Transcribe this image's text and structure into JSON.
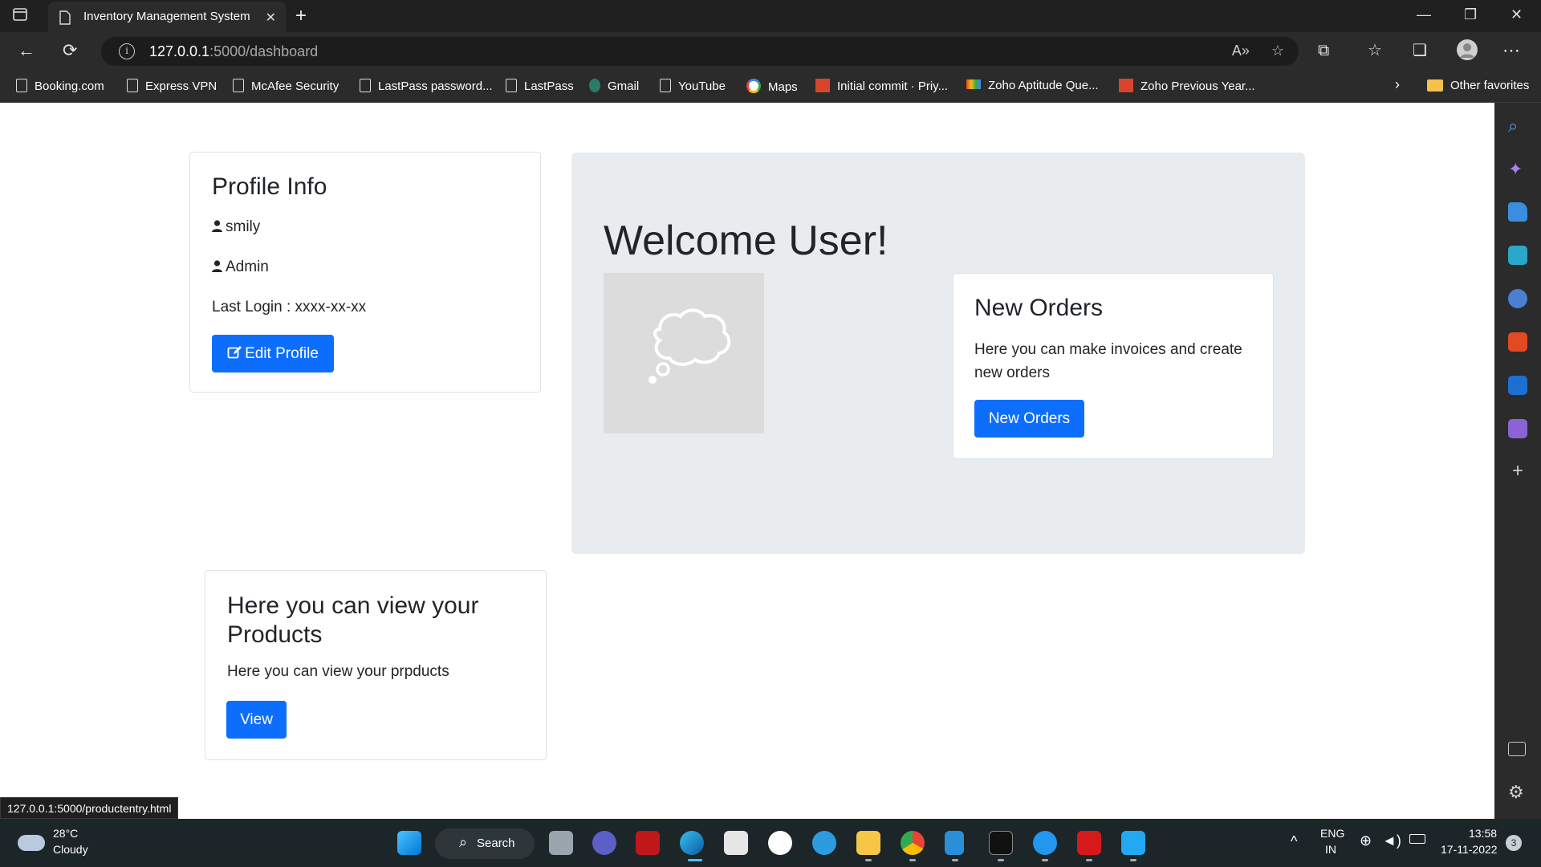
{
  "browser": {
    "tab_title": "Inventory Management System",
    "url_host": "127.0.0.1",
    "url_path": ":5000/dashboard",
    "bookmarks": [
      {
        "label": "Booking.com",
        "icon": "file-icon"
      },
      {
        "label": "Express VPN",
        "icon": "file-icon"
      },
      {
        "label": "McAfee Security",
        "icon": "file-icon"
      },
      {
        "label": "LastPass password...",
        "icon": "file-icon"
      },
      {
        "label": "LastPass",
        "icon": "file-icon"
      },
      {
        "label": "Gmail",
        "icon": "gmail-icon"
      },
      {
        "label": "YouTube",
        "icon": "file-icon"
      },
      {
        "label": "Maps",
        "icon": "google-icon"
      },
      {
        "label": "Initial commit · Priy...",
        "icon": "site-icon"
      },
      {
        "label": "Zoho Aptitude Que...",
        "icon": "gmail-m-icon"
      },
      {
        "label": "Zoho Previous Year...",
        "icon": "site-icon"
      }
    ],
    "other_favorites": "Other favorites",
    "status_url": "127.0.0.1:5000/productentry.html"
  },
  "profile": {
    "title": "Profile Info",
    "username": "smily",
    "role": "Admin",
    "last_login": "Last Login : xxxx-xx-xx",
    "edit_button": "Edit Profile"
  },
  "welcome": {
    "heading": "Welcome User!"
  },
  "orders": {
    "title": "New Orders",
    "text": "Here you can make invoices and create new orders",
    "button": "New Orders"
  },
  "products": {
    "title": "Here you can view your Products",
    "text": "Here you can view your prpducts",
    "button": "View"
  },
  "taskbar": {
    "weather_temp": "28°C",
    "weather_desc": "Cloudy",
    "search_label": "Search",
    "lang_top": "ENG",
    "lang_bottom": "IN",
    "time": "13:58",
    "date": "17-11-2022",
    "notification_count": "3"
  },
  "colors": {
    "primary": "#0d6efd",
    "jumbotron": "#e9ecef",
    "chrome_dark": "#2b2b2b"
  }
}
